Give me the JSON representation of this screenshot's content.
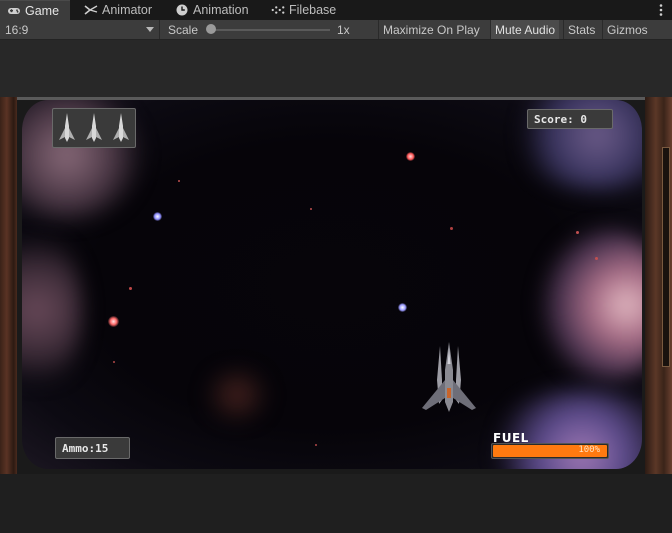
{
  "tabs": [
    {
      "label": "Game",
      "icon": "gamepad-icon",
      "active": true
    },
    {
      "label": "Animator",
      "icon": "animator-icon",
      "active": false
    },
    {
      "label": "Animation",
      "icon": "clock-icon",
      "active": false
    },
    {
      "label": "Filebase",
      "icon": "filebase-icon",
      "active": false
    }
  ],
  "toolbar": {
    "aspect": "16:9",
    "scale_label": "Scale",
    "scale_value": "1x",
    "scale_slider_fraction": 0.0,
    "maximize_on_play": "Maximize On Play",
    "mute_audio": "Mute Audio",
    "stats": "Stats",
    "gizmos": "Gizmos"
  },
  "game": {
    "score": "Score: 0",
    "ammo": "Ammo:15",
    "fuel_label": "FUEL",
    "fuel_percent_text": "100%",
    "fuel_fraction": 1.0,
    "lives_count": 3
  },
  "colors": {
    "editor_bg": "#282828",
    "tab_bar": "#191919",
    "toolbar": "#3c3c3c",
    "fuel_fill": "#ff7a10",
    "hud_box": "#3a3a3a"
  }
}
